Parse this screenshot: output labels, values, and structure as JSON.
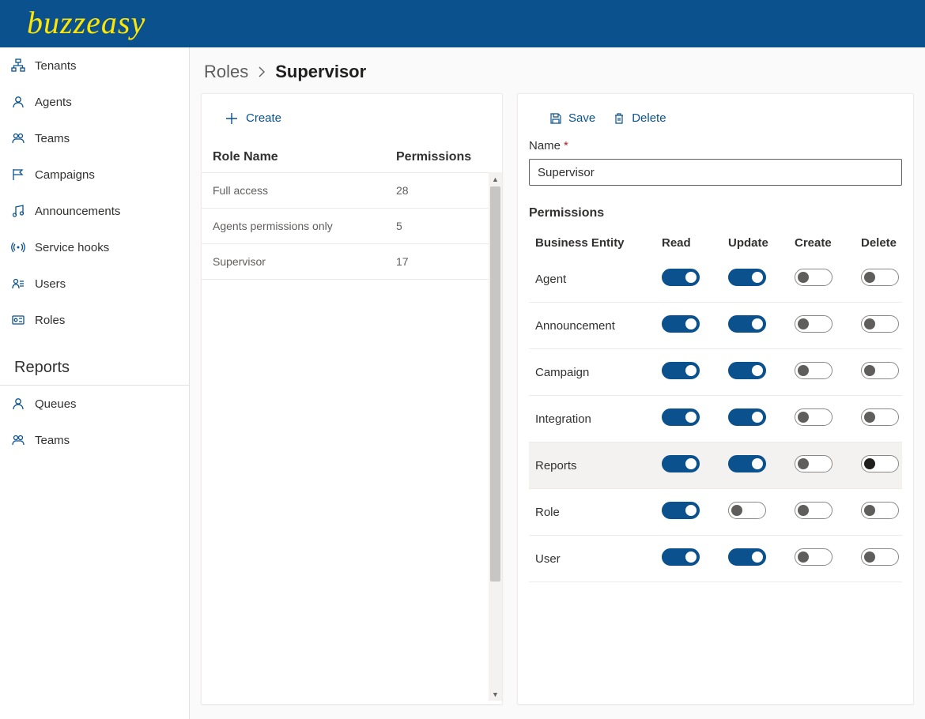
{
  "brand": "buzzeasy",
  "sidebar": {
    "items": [
      {
        "label": "Tenants",
        "icon": "sitemap"
      },
      {
        "label": "Agents",
        "icon": "agent"
      },
      {
        "label": "Teams",
        "icon": "team"
      },
      {
        "label": "Campaigns",
        "icon": "flag"
      },
      {
        "label": "Announcements",
        "icon": "music"
      },
      {
        "label": "Service hooks",
        "icon": "broadcast"
      },
      {
        "label": "Users",
        "icon": "users"
      },
      {
        "label": "Roles",
        "icon": "role"
      }
    ],
    "section": "Reports",
    "reportItems": [
      {
        "label": "Queues",
        "icon": "agent"
      },
      {
        "label": "Teams",
        "icon": "team"
      }
    ]
  },
  "breadcrumb": {
    "root": "Roles",
    "current": "Supervisor"
  },
  "leftPanel": {
    "createLabel": "Create",
    "columns": {
      "name": "Role Name",
      "perm": "Permissions"
    },
    "rows": [
      {
        "name": "Full access",
        "perm": "28"
      },
      {
        "name": "Agents permissions only",
        "perm": "5"
      },
      {
        "name": "Supervisor",
        "perm": "17"
      }
    ]
  },
  "rightPanel": {
    "saveLabel": "Save",
    "deleteLabel": "Delete",
    "nameLabel": "Name",
    "nameValue": "Supervisor",
    "permTitle": "Permissions",
    "columns": {
      "entity": "Business Entity",
      "read": "Read",
      "update": "Update",
      "create": "Create",
      "delete": "Delete"
    },
    "rows": [
      {
        "entity": "Agent",
        "read": true,
        "update": true,
        "create": false,
        "delete": false,
        "highlight": false
      },
      {
        "entity": "Announcement",
        "read": true,
        "update": true,
        "create": false,
        "delete": false,
        "highlight": false
      },
      {
        "entity": "Campaign",
        "read": true,
        "update": true,
        "create": false,
        "delete": false,
        "highlight": false
      },
      {
        "entity": "Integration",
        "read": true,
        "update": true,
        "create": false,
        "delete": false,
        "highlight": false
      },
      {
        "entity": "Reports",
        "read": true,
        "update": true,
        "create": false,
        "delete": false,
        "highlight": true,
        "darkDelete": true
      },
      {
        "entity": "Role",
        "read": true,
        "update": false,
        "create": false,
        "delete": false,
        "highlight": false
      },
      {
        "entity": "User",
        "read": true,
        "update": true,
        "create": false,
        "delete": false,
        "highlight": false
      }
    ]
  }
}
